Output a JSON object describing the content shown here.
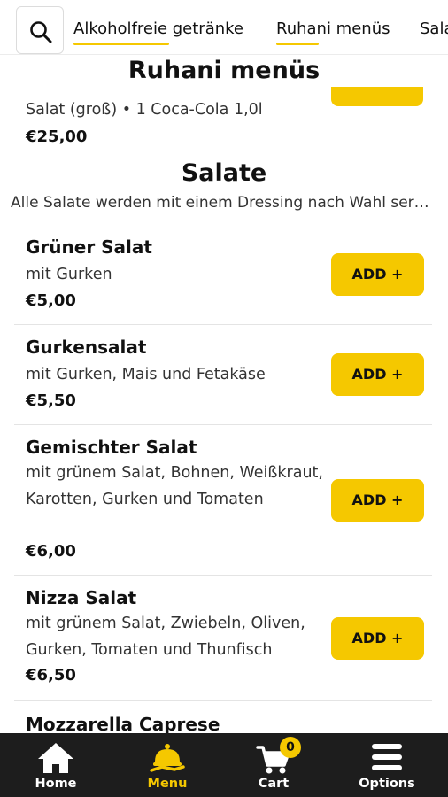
{
  "category_tabs": [
    {
      "label": "Alkoholfreie getränke"
    },
    {
      "label": "Ruhani menüs"
    },
    {
      "label": "Salate"
    }
  ],
  "previous_section": {
    "title": "Ruhani menüs",
    "last_item_desc": "Salat (groß) • 1 Coca-Cola 1,0l",
    "last_item_price": "€25,00"
  },
  "section": {
    "title": "Salate",
    "subtitle": "Alle Salate werden mit einem Dressing nach Wahl serviert"
  },
  "items": [
    {
      "name": "Grüner Salat",
      "desc": "mit Gurken",
      "price": "€5,00",
      "button": "ADD +"
    },
    {
      "name": "Gurkensalat",
      "desc": "mit Gurken, Mais und Fetakäse",
      "price": "€5,50",
      "button": "ADD +"
    },
    {
      "name": "Gemischter Salat",
      "desc": "mit grünem Salat, Bohnen, Weißkraut, Karotten, Gurken und Tomaten",
      "price": "€6,00",
      "button": "ADD +"
    },
    {
      "name": "Nizza Salat",
      "desc": "mit grünem Salat, Zwiebeln, Oliven, Gurken, Tomaten und Thunfisch",
      "price": "€6,50",
      "button": "ADD +"
    },
    {
      "name": "Mozzarella Caprese"
    }
  ],
  "bottom_nav": [
    {
      "label": "Home",
      "icon": "home-icon"
    },
    {
      "label": "Menu",
      "icon": "menu-icon",
      "active": true
    },
    {
      "label": "Cart",
      "icon": "cart-icon",
      "badge": "0"
    },
    {
      "label": "Options",
      "icon": "hamburger-icon"
    }
  ],
  "colors": {
    "accent": "#f5c800",
    "nav_bg": "#1d1d1d"
  }
}
